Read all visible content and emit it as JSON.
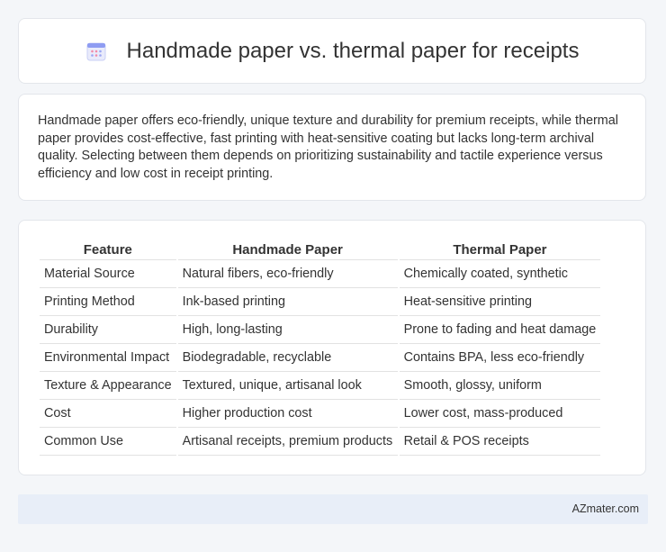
{
  "header": {
    "title": "Handmade paper vs. thermal paper for receipts",
    "icon": "calendar-icon",
    "accent_color": "#7b8ff0"
  },
  "summary": {
    "text": "Handmade paper offers eco-friendly, unique texture and durability for premium receipts, while thermal paper provides cost-effective, fast printing with heat-sensitive coating but lacks long-term archival quality. Selecting between them depends on prioritizing sustainability and tactile experience versus efficiency and low cost in receipt printing."
  },
  "table": {
    "headers": [
      "Feature",
      "Handmade Paper",
      "Thermal Paper"
    ],
    "rows": [
      [
        "Material Source",
        "Natural fibers, eco-friendly",
        "Chemically coated, synthetic"
      ],
      [
        "Printing Method",
        "Ink-based printing",
        "Heat-sensitive printing"
      ],
      [
        "Durability",
        "High, long-lasting",
        "Prone to fading and heat damage"
      ],
      [
        "Environmental Impact",
        "Biodegradable, recyclable",
        "Contains BPA, less eco-friendly"
      ],
      [
        "Texture & Appearance",
        "Textured, unique, artisanal look",
        "Smooth, glossy, uniform"
      ],
      [
        "Cost",
        "Higher production cost",
        "Lower cost, mass-produced"
      ],
      [
        "Common Use",
        "Artisanal receipts, premium products",
        "Retail & POS receipts"
      ]
    ]
  },
  "footer": {
    "link_text": "AZmater.com"
  }
}
